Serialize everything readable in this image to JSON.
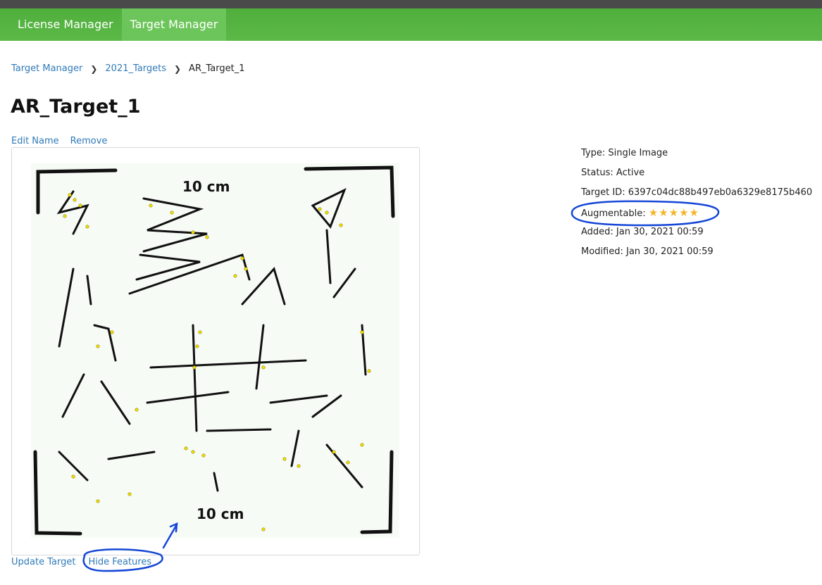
{
  "nav": {
    "tabs": [
      {
        "label": "License Manager"
      },
      {
        "label": "Target Manager"
      }
    ]
  },
  "breadcrumb": {
    "root": "Target Manager",
    "db": "2021_Targets",
    "current": "AR_Target_1"
  },
  "title": "AR_Target_1",
  "actions": {
    "edit_name": "Edit Name",
    "remove": "Remove"
  },
  "image_text": {
    "top_label": "10 cm",
    "bottom_label": "10 cm"
  },
  "bottom_actions": {
    "update": "Update Target",
    "hide_features": "Hide Features"
  },
  "info": {
    "type": "Type: Single Image",
    "status": "Status: Active",
    "target_id": "Target ID: 6397c04dc88b497eb0a6329e8175b460",
    "augmentable_label": "Augmentable:",
    "augmentable_stars": "★★★★★",
    "augmentable_rating": 5,
    "added": "Added: Jan 30, 2021 00:59",
    "modified": "Modified: Jan 30, 2021 00:59"
  },
  "colors": {
    "nav_green": "#5cb947",
    "active_tab": "#6cc55a",
    "link": "#2f7ab8",
    "annotation": "#1546d6",
    "feature": "#f5e400"
  }
}
